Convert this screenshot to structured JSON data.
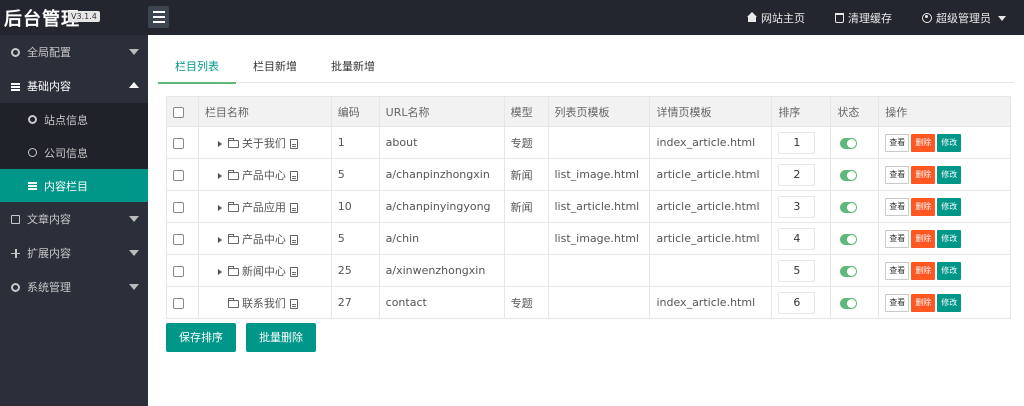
{
  "header": {
    "title": "后台管理",
    "version": "V3.1.4",
    "links": [
      {
        "label": "网站主页",
        "icon": "home-icon"
      },
      {
        "label": "清理缓存",
        "icon": "trash-icon"
      },
      {
        "label": "超级管理员",
        "icon": "user-icon"
      }
    ]
  },
  "sidebar": {
    "items": [
      {
        "label": "全局配置",
        "icon": "gear-icon",
        "expanded": false
      },
      {
        "label": "基础内容",
        "icon": "list-icon",
        "expanded": true,
        "children": [
          {
            "label": "站点信息",
            "icon": "gear-icon",
            "active": false
          },
          {
            "label": "公司信息",
            "icon": "circle-icon",
            "active": false
          },
          {
            "label": "内容栏目",
            "icon": "list-icon",
            "active": true
          }
        ]
      },
      {
        "label": "文章内容",
        "icon": "doc-icon",
        "expanded": false
      },
      {
        "label": "扩展内容",
        "icon": "expand-icon",
        "expanded": false
      },
      {
        "label": "系统管理",
        "icon": "gear-icon",
        "expanded": false
      }
    ]
  },
  "tabs": [
    {
      "label": "栏目列表",
      "active": true
    },
    {
      "label": "栏目新增",
      "active": false
    },
    {
      "label": "批量新增",
      "active": false
    }
  ],
  "table": {
    "headers": [
      "",
      "栏目名称",
      "编码",
      "URL名称",
      "模型",
      "列表页模板",
      "详情页模板",
      "排序",
      "状态",
      "操作"
    ],
    "rows": [
      {
        "name": "关于我们",
        "has_children": true,
        "code": "1",
        "url": "about",
        "model": "专题",
        "list_tpl": "",
        "detail_tpl": "index_article.html",
        "sort": "1",
        "status": true
      },
      {
        "name": "产品中心",
        "has_children": true,
        "code": "5",
        "url": "a/chanpinzhongxin",
        "model": "新闻",
        "list_tpl": "list_image.html",
        "detail_tpl": "article_article.html",
        "sort": "2",
        "status": true
      },
      {
        "name": "产品应用",
        "has_children": true,
        "code": "10",
        "url": "a/chanpinyingyong",
        "model": "新闻",
        "list_tpl": "list_article.html",
        "detail_tpl": "article_article.html",
        "sort": "3",
        "status": true
      },
      {
        "name": "产品中心",
        "has_children": true,
        "code": "5",
        "url": "a/chin",
        "model": "",
        "list_tpl": "list_image.html",
        "detail_tpl": "article_article.html",
        "sort": "4",
        "status": true
      },
      {
        "name": "新闻中心",
        "has_children": true,
        "code": "25",
        "url": "a/xinwenzhongxin",
        "model": "",
        "list_tpl": "",
        "detail_tpl": "",
        "sort": "5",
        "status": true
      },
      {
        "name": "联系我们",
        "has_children": false,
        "code": "27",
        "url": "contact",
        "model": "专题",
        "list_tpl": "",
        "detail_tpl": "index_article.html",
        "sort": "6",
        "status": true
      }
    ],
    "op_labels": {
      "view": "查看",
      "delete": "删除",
      "edit": "修改"
    }
  },
  "actions": {
    "save_sort": "保存排序",
    "batch_delete": "批量删除"
  },
  "colors": {
    "topbar": "#23262e",
    "sidebar": "#2b2f3a",
    "accent": "#009688",
    "danger": "#ff5722",
    "switch_on": "#5fb878"
  }
}
